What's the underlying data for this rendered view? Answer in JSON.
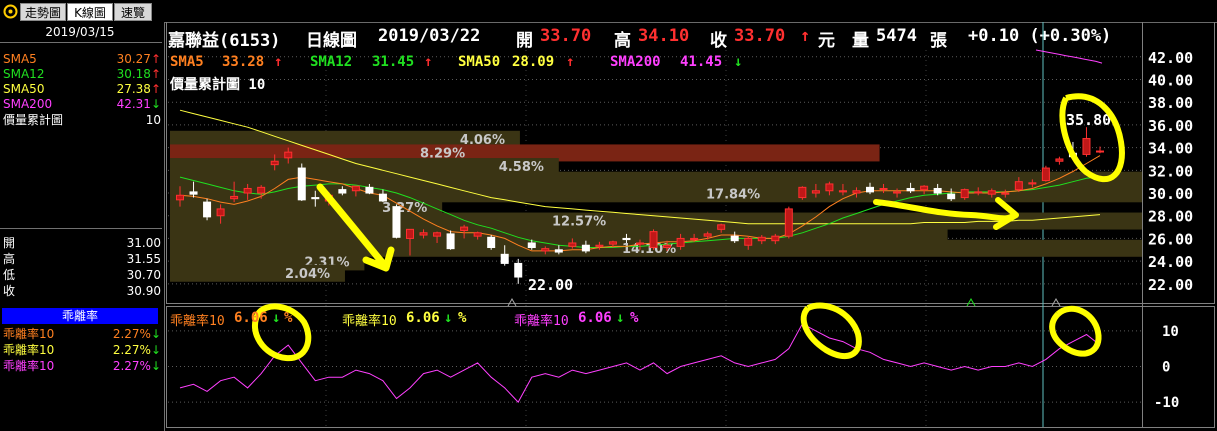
{
  "tabs": [
    {
      "icon": "settings-icon",
      "label": ""
    },
    {
      "label": "走勢圖"
    },
    {
      "label": "K線圖"
    },
    {
      "label": "速覽"
    }
  ],
  "left_panel": {
    "date": "2019/03/15",
    "ma_rows": [
      {
        "name": "SMA5",
        "value": "30.27",
        "dir": "up",
        "color": "#ff8020"
      },
      {
        "name": "SMA12",
        "value": "30.18",
        "dir": "up",
        "color": "#20e020"
      },
      {
        "name": "SMA50",
        "value": "27.38",
        "dir": "up",
        "color": "#ffff40"
      },
      {
        "name": "SMA200",
        "value": "42.31",
        "dir": "down",
        "color": "#ff40ff"
      }
    ],
    "vol_label": "價量累計圖",
    "vol_value": "10",
    "ohlc": [
      {
        "name": "開",
        "value": "31.00"
      },
      {
        "name": "高",
        "value": "31.55"
      },
      {
        "name": "低",
        "value": "30.70"
      },
      {
        "name": "收",
        "value": "30.90"
      }
    ],
    "bias_title": "乖離率",
    "bias_rows": [
      {
        "name": "乖離率10",
        "value": "2.27%",
        "dir": "down",
        "color": "#ff8020"
      },
      {
        "name": "乖離率10",
        "value": "2.27%",
        "dir": "down",
        "color": "#ffff40"
      },
      {
        "name": "乖離率10",
        "value": "2.27%",
        "dir": "down",
        "color": "#ff40ff"
      }
    ]
  },
  "header": {
    "stock": "嘉聯益(6153)",
    "chart_type": "日線圖",
    "date": "2019/03/22",
    "open_label": "開",
    "open": "33.70",
    "high_label": "高",
    "high": "34.10",
    "close_label": "收",
    "close": "33.70",
    "close_arrow": "↑",
    "currency": "元",
    "volume_label": "量",
    "volume": "5474",
    "volume_unit": "張",
    "change": "+0.10 (+0.30%)"
  },
  "indicators": {
    "sma5": {
      "label": "SMA5",
      "value": "33.28",
      "arrow": "↑"
    },
    "sma12": {
      "label": "SMA12",
      "value": "31.45",
      "arrow": "↑"
    },
    "sma50": {
      "label": "SMA50",
      "value": "28.09",
      "arrow": "↑"
    },
    "sma200": {
      "label": "SMA200",
      "value": "41.45",
      "arrow": "↓"
    },
    "vol_profile": "價量累計圖 10"
  },
  "bias_indicators": [
    {
      "label": "乖離率10",
      "value": "6.06",
      "arrow": "↓",
      "pct": "%",
      "color": "#ff8020"
    },
    {
      "label": "乖離率10",
      "value": "6.06",
      "arrow": "↓",
      "pct": "%",
      "color": "#ffff40"
    },
    {
      "label": "乖離率10",
      "value": "6.06",
      "arrow": "↓",
      "pct": "%",
      "color": "#ff40ff"
    }
  ],
  "colors": {
    "up": "#ff3030",
    "down": "#20e020",
    "sma5": "#ff8020",
    "sma12": "#20e020",
    "sma50": "#ffff40",
    "sma200": "#ff40ff",
    "annot": "#ffff00"
  },
  "chart_data": {
    "type": "candlestick",
    "price_axis": {
      "ticks": [
        "42.00",
        "40.00",
        "38.00",
        "36.00",
        "34.00",
        "32.00",
        "30.00",
        "28.00",
        "26.00",
        "24.00",
        "22.00"
      ],
      "ylim": [
        20.4,
        42.6
      ]
    },
    "bias_axis": {
      "ticks": [
        "10",
        "0",
        "-10"
      ],
      "ylim": [
        -17,
        17
      ]
    },
    "annotations": {
      "low": "22.00",
      "high": "35.80"
    },
    "volume_profile": [
      {
        "price": 34.6,
        "pct": "4.06%",
        "len": 0.36,
        "hi": false
      },
      {
        "price": 33.4,
        "pct": "8.29%",
        "len": 0.73,
        "hi": true
      },
      {
        "price": 32.2,
        "pct": "4.58%",
        "len": 0.4,
        "hi": false
      },
      {
        "price": 31.0,
        "pct": "",
        "len": 1.0,
        "hi": false
      },
      {
        "price": 29.8,
        "pct": "17.84%",
        "len": 1.0,
        "hi": false
      },
      {
        "price": 28.6,
        "pct": "3.27%",
        "len": 0.28,
        "hi": false
      },
      {
        "price": 27.4,
        "pct": "12.57%",
        "len": 1.0,
        "hi": false
      },
      {
        "price": 26.2,
        "pct": "",
        "len": 0.8,
        "hi": false
      },
      {
        "price": 25.0,
        "pct": "14.10%",
        "len": 1.0,
        "hi": false
      },
      {
        "price": 23.8,
        "pct": "2.31%",
        "len": 0.2,
        "hi": false
      },
      {
        "price": 22.8,
        "pct": "2.04%",
        "len": 0.18,
        "hi": false
      }
    ],
    "candles": [
      {
        "o": 29.4,
        "h": 30.6,
        "l": 28.8,
        "c": 29.8
      },
      {
        "o": 30.1,
        "h": 31.0,
        "l": 29.6,
        "c": 29.9
      },
      {
        "o": 29.2,
        "h": 29.5,
        "l": 27.6,
        "c": 27.9
      },
      {
        "o": 28.0,
        "h": 29.0,
        "l": 27.3,
        "c": 28.6
      },
      {
        "o": 29.5,
        "h": 31.0,
        "l": 29.2,
        "c": 29.7
      },
      {
        "o": 30.0,
        "h": 30.8,
        "l": 29.4,
        "c": 30.4
      },
      {
        "o": 30.0,
        "h": 30.7,
        "l": 29.5,
        "c": 30.5
      },
      {
        "o": 32.5,
        "h": 33.4,
        "l": 32.0,
        "c": 32.8
      },
      {
        "o": 33.1,
        "h": 34.0,
        "l": 32.6,
        "c": 33.6
      },
      {
        "o": 32.2,
        "h": 32.6,
        "l": 29.3,
        "c": 29.4
      },
      {
        "o": 29.6,
        "h": 30.2,
        "l": 28.8,
        "c": 29.5
      },
      {
        "o": 29.3,
        "h": 30.1,
        "l": 28.9,
        "c": 29.8
      },
      {
        "o": 30.3,
        "h": 30.6,
        "l": 29.8,
        "c": 30.0
      },
      {
        "o": 30.2,
        "h": 30.6,
        "l": 29.7,
        "c": 30.6
      },
      {
        "o": 30.5,
        "h": 30.8,
        "l": 29.9,
        "c": 30.0
      },
      {
        "o": 29.9,
        "h": 30.3,
        "l": 29.2,
        "c": 29.3
      },
      {
        "o": 28.8,
        "h": 29.0,
        "l": 26.0,
        "c": 26.1
      },
      {
        "o": 26.0,
        "h": 26.5,
        "l": 24.5,
        "c": 26.8
      },
      {
        "o": 26.3,
        "h": 26.8,
        "l": 26.0,
        "c": 26.5
      },
      {
        "o": 26.2,
        "h": 26.6,
        "l": 25.6,
        "c": 26.5
      },
      {
        "o": 26.4,
        "h": 26.7,
        "l": 25.0,
        "c": 25.1
      },
      {
        "o": 26.7,
        "h": 27.2,
        "l": 26.0,
        "c": 27.0
      },
      {
        "o": 26.2,
        "h": 26.6,
        "l": 25.9,
        "c": 26.5
      },
      {
        "o": 26.1,
        "h": 26.3,
        "l": 25.0,
        "c": 25.2
      },
      {
        "o": 24.6,
        "h": 25.4,
        "l": 23.6,
        "c": 23.8
      },
      {
        "o": 23.8,
        "h": 24.2,
        "l": 22.0,
        "c": 22.6
      },
      {
        "o": 25.6,
        "h": 25.9,
        "l": 25.0,
        "c": 25.2
      },
      {
        "o": 24.9,
        "h": 25.3,
        "l": 24.6,
        "c": 25.1
      },
      {
        "o": 25.0,
        "h": 25.4,
        "l": 24.6,
        "c": 24.8
      },
      {
        "o": 25.3,
        "h": 26.0,
        "l": 25.1,
        "c": 25.6
      },
      {
        "o": 25.4,
        "h": 25.8,
        "l": 24.7,
        "c": 24.9
      },
      {
        "o": 25.3,
        "h": 25.7,
        "l": 25.0,
        "c": 25.4
      },
      {
        "o": 25.5,
        "h": 25.8,
        "l": 25.2,
        "c": 25.7
      },
      {
        "o": 26.0,
        "h": 26.4,
        "l": 25.6,
        "c": 25.9
      },
      {
        "o": 25.5,
        "h": 25.9,
        "l": 25.0,
        "c": 25.6
      },
      {
        "o": 25.2,
        "h": 26.8,
        "l": 25.0,
        "c": 26.6
      },
      {
        "o": 25.2,
        "h": 25.8,
        "l": 24.9,
        "c": 25.4
      },
      {
        "o": 25.3,
        "h": 26.4,
        "l": 25.0,
        "c": 26.0
      },
      {
        "o": 25.9,
        "h": 26.4,
        "l": 25.7,
        "c": 26.0
      },
      {
        "o": 26.2,
        "h": 26.6,
        "l": 25.9,
        "c": 26.4
      },
      {
        "o": 26.8,
        "h": 27.3,
        "l": 26.5,
        "c": 27.2
      },
      {
        "o": 26.2,
        "h": 26.6,
        "l": 25.6,
        "c": 25.8
      },
      {
        "o": 25.4,
        "h": 26.2,
        "l": 25.0,
        "c": 26.0
      },
      {
        "o": 25.8,
        "h": 26.3,
        "l": 25.5,
        "c": 26.1
      },
      {
        "o": 25.8,
        "h": 26.4,
        "l": 25.5,
        "c": 26.2
      },
      {
        "o": 26.2,
        "h": 28.8,
        "l": 26.0,
        "c": 28.6
      },
      {
        "o": 29.6,
        "h": 30.6,
        "l": 29.4,
        "c": 30.5
      },
      {
        "o": 30.0,
        "h": 30.8,
        "l": 29.6,
        "c": 30.2
      },
      {
        "o": 30.2,
        "h": 31.0,
        "l": 29.8,
        "c": 30.8
      },
      {
        "o": 30.1,
        "h": 30.8,
        "l": 29.8,
        "c": 30.2
      },
      {
        "o": 30.0,
        "h": 30.5,
        "l": 29.6,
        "c": 30.2
      },
      {
        "o": 30.5,
        "h": 30.9,
        "l": 29.9,
        "c": 30.1
      },
      {
        "o": 30.4,
        "h": 30.8,
        "l": 30.0,
        "c": 30.4
      },
      {
        "o": 30.0,
        "h": 30.4,
        "l": 29.6,
        "c": 30.1
      },
      {
        "o": 30.4,
        "h": 30.9,
        "l": 30.0,
        "c": 30.2
      },
      {
        "o": 30.3,
        "h": 30.7,
        "l": 29.9,
        "c": 30.6
      },
      {
        "o": 30.4,
        "h": 30.8,
        "l": 29.8,
        "c": 30.0
      },
      {
        "o": 29.9,
        "h": 30.4,
        "l": 29.3,
        "c": 29.5
      },
      {
        "o": 29.6,
        "h": 30.4,
        "l": 29.4,
        "c": 30.3
      },
      {
        "o": 30.1,
        "h": 30.5,
        "l": 29.8,
        "c": 30.1
      },
      {
        "o": 29.9,
        "h": 30.4,
        "l": 29.6,
        "c": 30.2
      },
      {
        "o": 29.9,
        "h": 30.3,
        "l": 29.6,
        "c": 30.0
      },
      {
        "o": 30.3,
        "h": 31.4,
        "l": 30.1,
        "c": 31.0
      },
      {
        "o": 30.8,
        "h": 31.2,
        "l": 30.5,
        "c": 30.9
      },
      {
        "o": 31.1,
        "h": 32.4,
        "l": 31.0,
        "c": 32.2
      },
      {
        "o": 32.8,
        "h": 33.2,
        "l": 32.5,
        "c": 33.0
      },
      {
        "o": 33.5,
        "h": 34.5,
        "l": 32.9,
        "c": 33.2
      },
      {
        "o": 33.4,
        "h": 35.8,
        "l": 33.2,
        "c": 34.8
      },
      {
        "o": 33.7,
        "h": 34.1,
        "l": 33.5,
        "c": 33.7
      }
    ],
    "sma5": [
      29.8,
      29.7,
      29.5,
      29.2,
      29.0,
      29.3,
      29.7,
      30.4,
      31.2,
      31.4,
      31.2,
      31.0,
      30.8,
      30.4,
      30.0,
      29.8,
      29.1,
      28.4,
      27.7,
      27.1,
      26.6,
      26.5,
      26.5,
      26.3,
      26.0,
      25.4,
      24.9,
      24.9,
      24.9,
      25.0,
      25.0,
      25.2,
      25.3,
      25.3,
      25.5,
      25.6,
      25.7,
      25.7,
      25.8,
      26.0,
      26.3,
      26.3,
      26.2,
      26.0,
      26.0,
      26.4,
      27.1,
      27.9,
      28.8,
      29.5,
      30.0,
      30.2,
      30.2,
      30.2,
      30.2,
      30.2,
      30.2,
      30.1,
      30.0,
      30.0,
      30.0,
      30.1,
      30.2,
      30.4,
      30.8,
      31.3,
      31.9,
      32.6,
      33.3
    ],
    "sma12": [
      31.4,
      31.1,
      30.8,
      30.5,
      30.2,
      30.0,
      29.9,
      30.1,
      30.4,
      30.6,
      30.7,
      30.8,
      30.8,
      30.7,
      30.5,
      30.3,
      30.0,
      29.6,
      29.1,
      28.6,
      28.1,
      27.6,
      27.2,
      26.9,
      26.5,
      26.1,
      25.8,
      25.6,
      25.4,
      25.3,
      25.2,
      25.2,
      25.2,
      25.3,
      25.3,
      25.4,
      25.5,
      25.6,
      25.7,
      25.8,
      25.9,
      26.0,
      26.0,
      26.0,
      26.0,
      26.2,
      26.5,
      26.9,
      27.3,
      27.8,
      28.2,
      28.6,
      29.0,
      29.3,
      29.6,
      29.8,
      29.9,
      30.0,
      30.1,
      30.1,
      30.1,
      30.1,
      30.2,
      30.3,
      30.5,
      30.7,
      31.0,
      31.3,
      31.45
    ],
    "sma50": [
      37.3,
      37.0,
      36.7,
      36.4,
      36.1,
      35.8,
      35.4,
      35.0,
      34.6,
      34.2,
      33.8,
      33.4,
      33.0,
      32.6,
      32.3,
      32.0,
      31.7,
      31.4,
      31.1,
      30.8,
      30.5,
      30.2,
      29.9,
      29.6,
      29.4,
      29.2,
      29.0,
      28.8,
      28.7,
      28.6,
      28.5,
      28.4,
      28.3,
      28.2,
      28.1,
      28.0,
      27.9,
      27.8,
      27.7,
      27.6,
      27.5,
      27.4,
      27.3,
      27.3,
      27.3,
      27.3,
      27.3,
      27.3,
      27.3,
      27.3,
      27.3,
      27.3,
      27.3,
      27.3,
      27.3,
      27.4,
      27.4,
      27.4,
      27.4,
      27.5,
      27.5,
      27.5,
      27.6,
      27.6,
      27.7,
      27.8,
      27.9,
      28.0,
      28.1
    ],
    "sma200": [
      42.6,
      42.5,
      42.4,
      42.3,
      42.2,
      42.1,
      42.0,
      41.9,
      41.8,
      41.7,
      41.6,
      41.45
    ],
    "bias": [
      -6,
      -5,
      -7,
      -4,
      -3,
      -6,
      -2,
      3,
      6,
      1,
      -4,
      -3,
      -3,
      -1,
      -2,
      -4,
      -9,
      -6,
      -2,
      -1,
      -3,
      -1,
      1,
      -3,
      -6,
      -10,
      -3,
      -2,
      -3,
      -1,
      -2,
      -1,
      0,
      1,
      -1,
      1,
      -2,
      0,
      1,
      2,
      3,
      1,
      0,
      1,
      2,
      5,
      12,
      10,
      8,
      7,
      5,
      4,
      2,
      1,
      0,
      1,
      0,
      -1,
      0,
      -1,
      0,
      0,
      1,
      0,
      2,
      5,
      7,
      9,
      6
    ]
  }
}
